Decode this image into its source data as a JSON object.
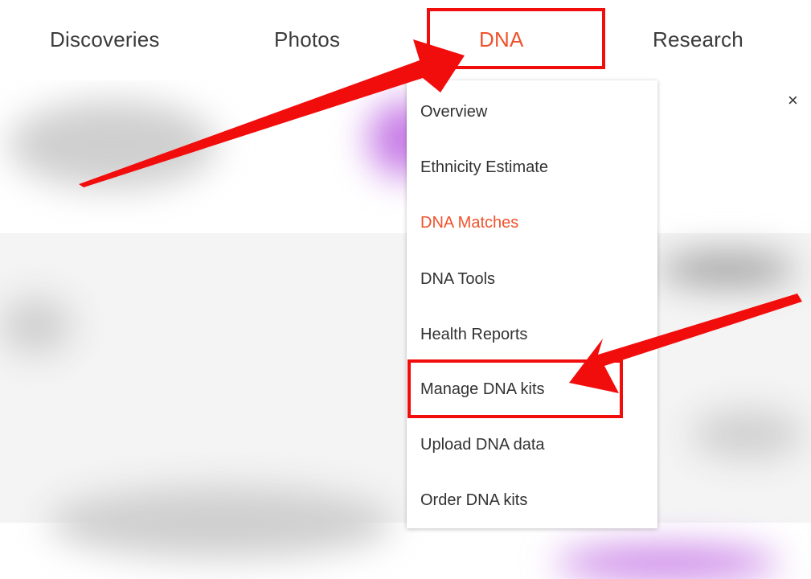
{
  "nav": {
    "items": [
      {
        "label": "Discoveries"
      },
      {
        "label": "Photos"
      },
      {
        "label": "DNA"
      },
      {
        "label": "Research"
      }
    ],
    "active": "DNA"
  },
  "dna_menu": {
    "items": [
      {
        "label": "Overview"
      },
      {
        "label": "Ethnicity Estimate"
      },
      {
        "label": "DNA Matches"
      },
      {
        "label": "DNA Tools"
      },
      {
        "label": "Health Reports"
      },
      {
        "label": "Manage DNA kits"
      },
      {
        "label": "Upload DNA data"
      },
      {
        "label": "Order DNA kits"
      }
    ],
    "active_item": "DNA Matches",
    "highlighted_item": "Manage DNA kits"
  },
  "close_icon": "×",
  "colors": {
    "accent": "#f0522b",
    "annotation": "#f20d0d",
    "text": "#333333"
  },
  "icons": {
    "close": "close-icon",
    "annotation_arrows": "arrow-icon"
  }
}
